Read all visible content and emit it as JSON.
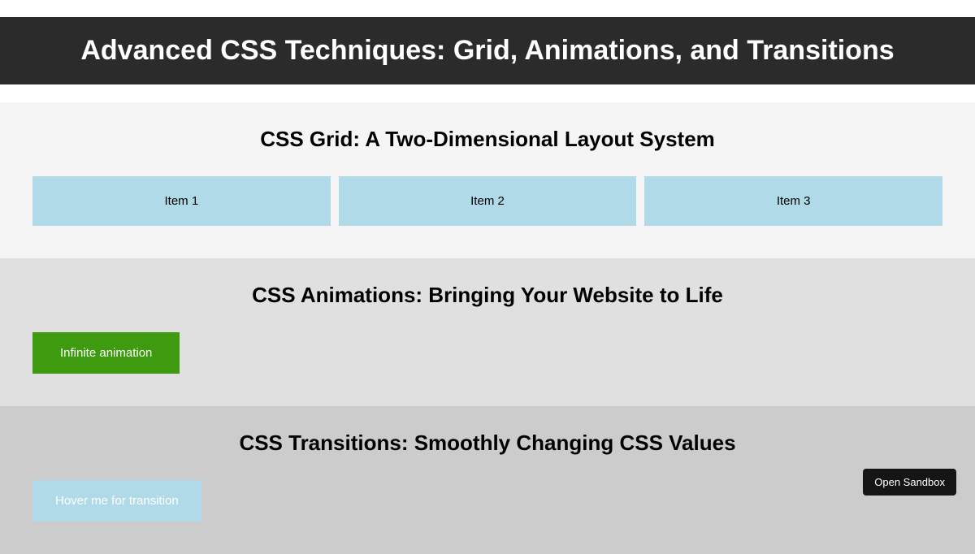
{
  "header": {
    "title": "Advanced CSS Techniques: Grid, Animations, and Transitions"
  },
  "sections": {
    "grid": {
      "title": "CSS Grid: A Two-Dimensional Layout System",
      "items": [
        "Item 1",
        "Item 2",
        "Item 3"
      ]
    },
    "animations": {
      "title": "CSS Animations: Bringing Your Website to Life",
      "box_label": "Infinite animation"
    },
    "transitions": {
      "title": "CSS Transitions: Smoothly Changing CSS Values",
      "box_label": "Hover me for transition"
    }
  },
  "sandbox": {
    "button_label": "Open Sandbox"
  }
}
